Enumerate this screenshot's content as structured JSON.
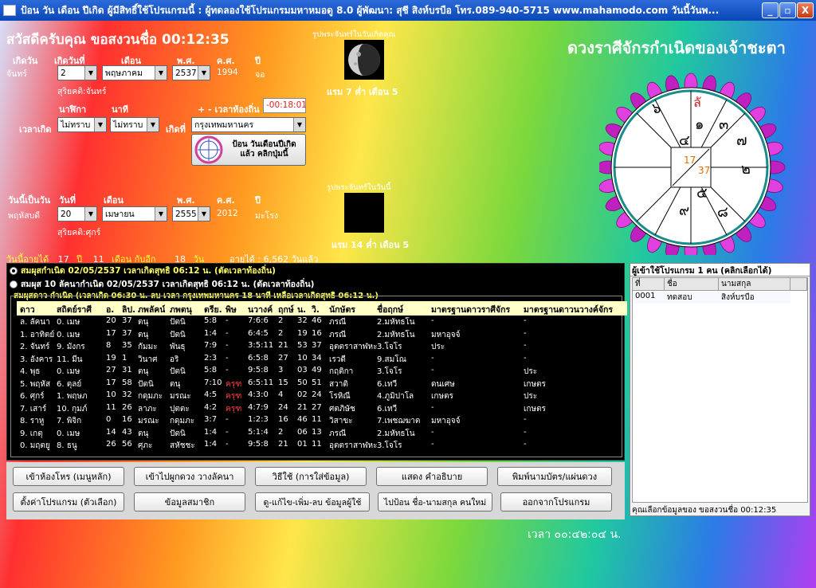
{
  "window": {
    "title": "ป้อน วัน เดือน ปีเกิด  ผู้มีสิทธิ์ใช้โปรแกรมนี้ : ผู้ทดลองใช้โปรแกรมมหาหมอดู 8.0        ผู้พัฒนา: สุชี สิงห์บรบือ โทร.089-940-5715 www.mahamodo.com  วันนี้วันพ...",
    "minimize": "_",
    "maximize": "▫",
    "close": "X"
  },
  "greeting": "สวัสดีครับคุณ ขอสงวนชื่อ 00:12:35",
  "birth": {
    "day_label": "เกิดวัน",
    "date_label": "เกิดวันที่",
    "month_label": "เดือน",
    "be_label": "พ.ศ.",
    "ce_label": "ค.ศ.",
    "year_label": "ปี",
    "day": "จันทร์",
    "date": "2",
    "month": "พฤษภาคม",
    "be": "2537",
    "ce": "1994",
    "year": "จอ",
    "suriyakati": "สุริยคติ:จันทร์",
    "time_label": "เวลาเกิด",
    "hour_label": "นาฬิกา",
    "minute_label": "นาที",
    "hour": "ไม่ทราบ",
    "minute": "ไม่ทราบ",
    "place_label": "เกิดที่",
    "place": "กรุงเทพมหานคร",
    "local_time_label": "+ - เวลาท้องถิ่น",
    "local_time": "-00:18:01",
    "submit": "ป้อน วันเดือนปีเกิด แล้ว คลิกปุ่มนี้"
  },
  "moon_birth": {
    "caption": "รูปพระจันทร์ในวันเกิดคุณ",
    "phase": "แรม 7 ค่ำ เดือน 5"
  },
  "today": {
    "day_label": "วันนี้เป็นวัน",
    "date_label": "วันที่",
    "month_label": "เดือน",
    "be_label": "พ.ศ.",
    "ce_label": "ค.ศ.",
    "year_label": "ปี",
    "day": "พฤหัสบดี",
    "date": "20",
    "month": "เมษายน",
    "be": "2555",
    "ce": "2012",
    "year": "มะโรง",
    "suriyakati": "สุริยคติ:ศุกร์"
  },
  "moon_today": {
    "caption": "รูปพระจันทร์ในวันนี้",
    "phase": "แรม 14 ค่ำ เดือน 5"
  },
  "age": {
    "prefix": "วันนี้อายุได้",
    "years": "17",
    "y_unit": "ปี",
    "months": "11",
    "m_unit": "เดือน กับอีก",
    "days": "18",
    "d_unit": "วัน",
    "total": "อายุได้ : 6,562 วันแล้ว"
  },
  "horoscope_title": "ดวงราศีจักรกำเนิดของเจ้าชะตา",
  "wheel": {
    "marks": [
      "ลั",
      "๑",
      "๖",
      "๓",
      "๗",
      "๔",
      "๒",
      "๕",
      "๘",
      "๙"
    ],
    "center_top": "17",
    "center_bottom": "37"
  },
  "options": {
    "opt1": "สมผุสกำเนิด 02/05/2537 เวลาเกิดสุทธิ 06:12 น. (ตัดเวลาท้องถิ่น)",
    "opt2": "สมผุส 10 ลัคนากำเนิด 02/05/2537 เวลาเกิดสุทธิ 06:12 น. (ตัดเวลาท้องถิ่น)",
    "caption": "สมผุสดาว กำเนิด (เวลาเกิด 06:30 น.  ลบ เวลา กรุงเทพมหานคร 18 นาที เหลือเวลาเกิดสุทธิ 06:12 น.)"
  },
  "table": {
    "headers": [
      "ดาว",
      "สถิตย์ราศี",
      "อ.",
      "ลิป.",
      "ภพลัคน์",
      "ภพตนุ",
      "ตรีย.",
      "พิษ",
      "นวางค์",
      "ฤกษ์",
      "น.",
      "วิ.",
      "นักษัตร",
      "ชื่อฤกษ์",
      "มาตรฐานดาวราศีจักร",
      "มาตรฐานดาวนวางค์จักร"
    ],
    "rows": [
      [
        "ล. ลัคนา",
        "0. เมษ",
        "20",
        "37",
        "ตนุ",
        "ปัตนิ",
        "5:8",
        "-",
        "7:6:6",
        "2",
        "32",
        "46",
        "ภรณี",
        "2.มหัทธโน",
        "-",
        "-"
      ],
      [
        "1. อาทิตย์",
        "0. เมษ",
        "17",
        "37",
        "ตนุ",
        "ปัตนิ",
        "1:4",
        "-",
        "6:4:5",
        "2",
        "19",
        "16",
        "ภรณี",
        "2.มหัทธโน",
        "มหาอุจจ์",
        "-"
      ],
      [
        "2. จันทร์",
        "9. มังกร",
        "8",
        "35",
        "กัมมะ",
        "พันธุ",
        "7:9",
        "-",
        "3:5:11",
        "21",
        "53",
        "37",
        "อุตตราสาฬหะ",
        "3.โจโร",
        "ประ",
        "-"
      ],
      [
        "3. อังคาร",
        "11. มีน",
        "19",
        "1",
        "วินาศ",
        "อริ",
        "2:3",
        "-",
        "6:5:8",
        "27",
        "10",
        "34",
        "เรวดี",
        "9.สมโณ",
        "-",
        "-"
      ],
      [
        "4. พุธ",
        "0. เมษ",
        "27",
        "31",
        "ตนุ",
        "ปัตนิ",
        "5:8",
        "-",
        "9:5:8",
        "3",
        "03",
        "49",
        "กฤติกา",
        "3.โจโร",
        "-",
        "ประ"
      ],
      [
        "5. พฤหัส",
        "6. ตุลย์",
        "17",
        "58",
        "ปัตนิ",
        "ตนุ",
        "7:10",
        "ครุฑ",
        "6:5:11",
        "15",
        "50",
        "51",
        "สวาติ",
        "6.เทวี",
        "ดนเศษ",
        "เกษตร"
      ],
      [
        "6. ศุกร์",
        "1. พฤษภ",
        "10",
        "32",
        "กดุมภะ",
        "มรณะ",
        "4:5",
        "ครุฑ",
        "4:3:0",
        "4",
        "02",
        "24",
        "โรหิณี",
        "4.ภูมิปาโล",
        "เกษตร",
        "ประ"
      ],
      [
        "7. เสาร์",
        "10. กุมภ์",
        "11",
        "26",
        "ลาภะ",
        "ปุตตะ",
        "4:2",
        "ครุฑ",
        "4:7:9",
        "24",
        "21",
        "27",
        "ศตภิษัช",
        "6.เทวี",
        "-",
        "เกษตร"
      ],
      [
        "8. ราหู",
        "7. พิจิก",
        "0",
        "16",
        "มรณะ",
        "กดุมภะ",
        "3:7",
        "-",
        "1:2:3",
        "16",
        "46",
        "11",
        "วิสาขะ",
        "7.เพชฌฆาต",
        "มหาอุจจ์",
        "-"
      ],
      [
        "9. เกตุ",
        "0. เมษ",
        "14",
        "43",
        "ตนุ",
        "ปัตนิ",
        "1:4",
        "-",
        "5:1:4",
        "2",
        "06",
        "13",
        "ภรณี",
        "2.มหัทธโน",
        "-",
        "-"
      ],
      [
        "0. มฤตยู",
        "8. ธนู",
        "26",
        "56",
        "ศุภะ",
        "สหัชชะ",
        "1:4",
        "-",
        "9:5:8",
        "21",
        "01",
        "11",
        "อุตตราสาฬหะ",
        "3.โจโร",
        "-",
        "-"
      ]
    ]
  },
  "buttons": {
    "main_menu": "เข้าห้องโหร (เมนูหลัก)",
    "pair": "เข้าไปผูกดวง วางลัคนา",
    "howto": "วิธีใช้ (การใส่ข้อมูล)",
    "explain": "แสดง คำอธิบาย",
    "print": "พิมพ์นามบัตร/แผ่นดวง",
    "settings": "ตั้งค่าโปรแกรม (ตัวเลือก)",
    "members": "ข้อมูลสมาชิก",
    "edit_users": "ดู-แก้ไข-เพิ่ม-ลบ ข้อมูลผู้ใช้",
    "new_name": "ไปป้อน ชื่อ-นามสกุล คนใหม่",
    "exit": "ออกจากโปรแกรม"
  },
  "users": {
    "title": "ผู้เข้าใช้โปรแกรม 1 คน (คลิกเลือกได้)",
    "headers": [
      "ที่",
      "ชื่อ",
      "นามสกุล"
    ],
    "rows": [
      [
        "0001",
        "ทดสอบ",
        "สิงห์บรบือ"
      ]
    ],
    "status": "คุณเลือกข้อมูลของ ขอสงวนชื่อ 00:12:35"
  },
  "clock": "เวลา ๐๐:๔๒:๐๔ น."
}
